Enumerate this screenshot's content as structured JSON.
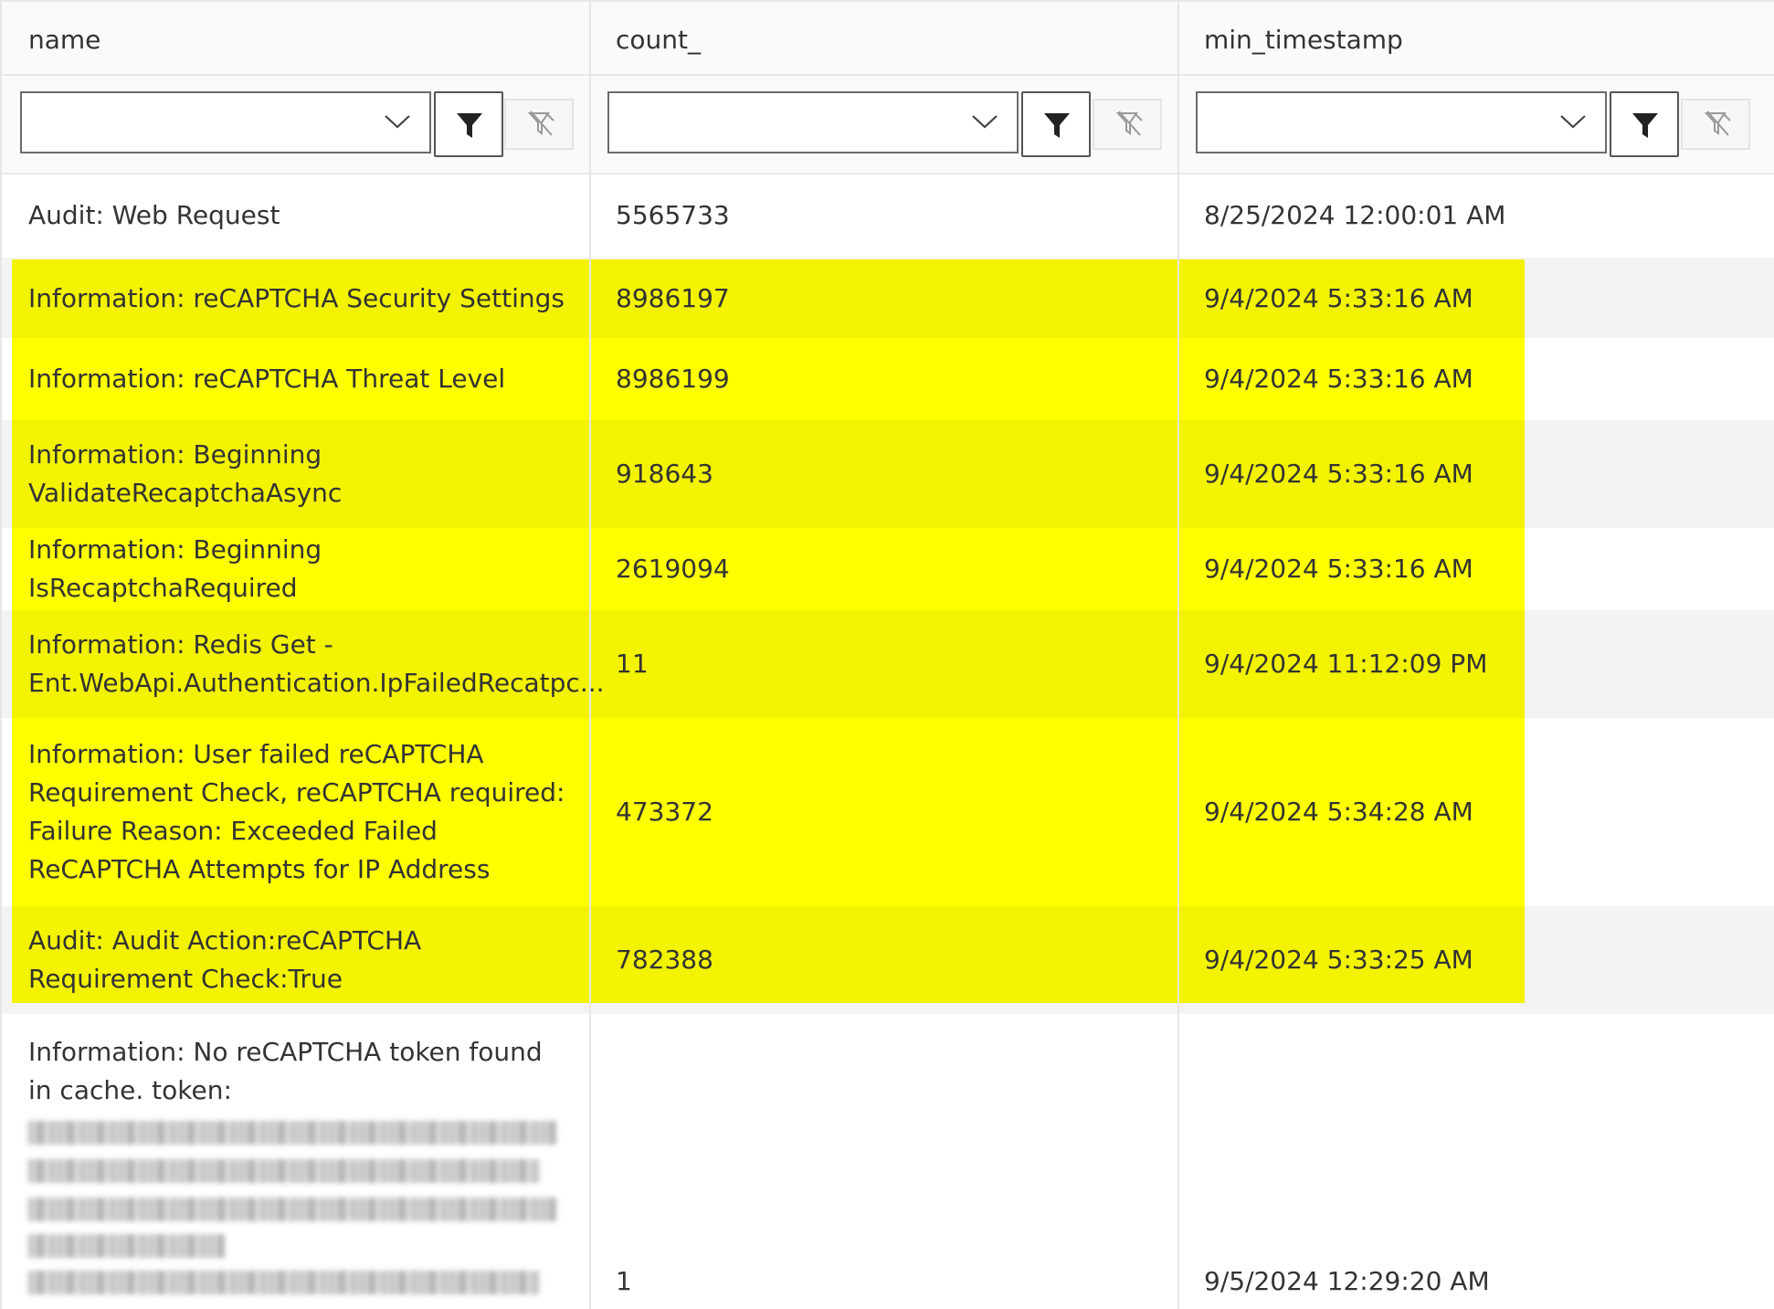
{
  "columns": [
    {
      "header": "name"
    },
    {
      "header": "count_"
    },
    {
      "header": "min_timestamp"
    }
  ],
  "filters": [
    {
      "value": ""
    },
    {
      "value": ""
    },
    {
      "value": ""
    }
  ],
  "rows": [
    {
      "name": "Audit: Web Request",
      "count": "5565733",
      "min_timestamp": "8/25/2024 12:00:01 AM"
    },
    {
      "name": "Information: reCAPTCHA Security Settings",
      "count": "8986197",
      "min_timestamp": "9/4/2024 5:33:16 AM"
    },
    {
      "name": "Information: reCAPTCHA Threat Level",
      "count": "8986199",
      "min_timestamp": "9/4/2024 5:33:16 AM"
    },
    {
      "name": "Information: Beginning ValidateRecaptchaAsync",
      "count": "918643",
      "min_timestamp": "9/4/2024 5:33:16 AM"
    },
    {
      "name": "Information: Beginning IsRecaptchaRequired",
      "count": "2619094",
      "min_timestamp": "9/4/2024 5:33:16 AM"
    },
    {
      "name": "Information: Redis Get - Ent.WebApi.Authentication.IpFailedRecatpc...",
      "count": "11",
      "min_timestamp": "9/4/2024 11:12:09 PM"
    },
    {
      "name": "Information: User failed reCAPTCHA Requirement Check, reCAPTCHA required: Failure Reason: Exceeded Failed ReCAPTCHA Attempts for IP Address",
      "count": "473372",
      "min_timestamp": "9/4/2024 5:34:28 AM"
    },
    {
      "name": "Audit: Audit Action:reCAPTCHA Requirement Check:True",
      "count": "782388",
      "min_timestamp": "9/4/2024 5:33:25 AM"
    },
    {
      "name": "Information: No reCAPTCHA token found in cache. token:",
      "count": "1",
      "min_timestamp": "9/5/2024 12:29:20 AM"
    }
  ],
  "highlight_colors": {
    "odd": "#f3f300",
    "even": "#ffff00"
  },
  "icons": {
    "dropdown": "chevron-down-icon",
    "filter": "filter-icon",
    "clear": "clear-filter-icon"
  }
}
